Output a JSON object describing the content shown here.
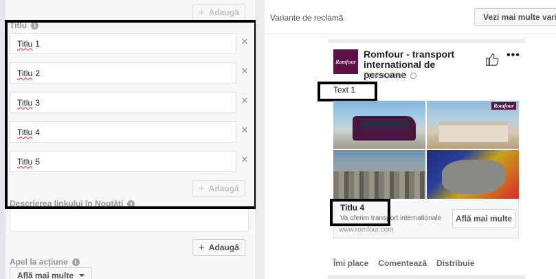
{
  "left": {
    "add_label": "Adaugă",
    "title_section_label": "Titlu",
    "titles": [
      "Titlu",
      "Titlu",
      "Titlu",
      "Titlu",
      "Titlu"
    ],
    "title_numbers": [
      "1",
      "2",
      "3",
      "4",
      "5"
    ],
    "description_label": "Descrierea linkului în Noutăți",
    "cta_section_label": "Apel la acțiune",
    "cta_value": "Află mai multe"
  },
  "right": {
    "variants_label": "Variante de reclamă",
    "more_variants_label": "Vezi mai multe variante",
    "post": {
      "avatar_text": "Romfour",
      "page_name": "Romfour - transport international de persoane",
      "sponsored": "Sponsorizat ·",
      "text": "Text 1",
      "link_title": "Titlu 4",
      "link_description": "Va oferim transport internationale",
      "link_url": "www.romfour.com",
      "cta_button": "Află mai multe",
      "actions": [
        "Îmi place",
        "Comentează",
        "Distribuie"
      ]
    }
  },
  "colors": {
    "brand": "#5b1247",
    "highlight_border": "#000000"
  }
}
